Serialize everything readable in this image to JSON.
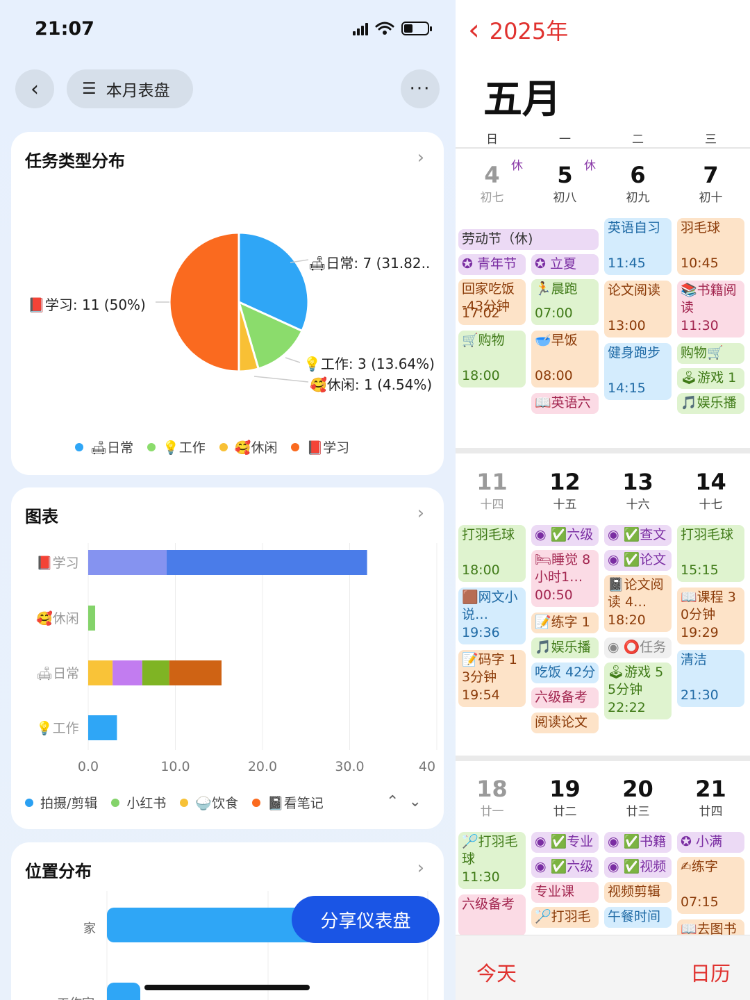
{
  "status_bar": {
    "time": "21:07"
  },
  "dashboard": {
    "title": "本月表盘",
    "more": "···",
    "share_button": "分享仪表盘",
    "pie_card": {
      "title": "任务类型分布",
      "labels": {
        "daily": "🛋日常: 7 (31.82..",
        "work": "💡工作: 3 (13.64%)",
        "leisure": "🥰休闲: 1 (4.54%)",
        "study": "📕学习: 11 (50%)"
      },
      "legend": [
        "🛋日常",
        "💡工作",
        "🥰休闲",
        "📕学习"
      ],
      "colors": [
        "#2fa6f6",
        "#8bdc6c",
        "#f8c035",
        "#fa6a1f"
      ]
    },
    "bar_card": {
      "title": "图表",
      "legend": [
        "拍摄/剪辑",
        "小红书",
        "🍚饮食",
        "📓看笔记"
      ],
      "legend_colors": [
        "#2aa0f2",
        "#84d36a",
        "#f7c136",
        "#fb6a1e"
      ]
    },
    "location_card": {
      "title": "位置分布",
      "rows": [
        "家",
        "工作室"
      ]
    }
  },
  "chart_data": [
    {
      "type": "pie",
      "title": "任务类型分布",
      "categories": [
        "日常",
        "工作",
        "休闲",
        "学习"
      ],
      "values": [
        7,
        3,
        1,
        11
      ],
      "percent": [
        31.82,
        13.64,
        4.54,
        50
      ]
    },
    {
      "type": "bar",
      "orientation": "horizontal",
      "title": "图表",
      "categories": [
        "学习",
        "休闲",
        "日常",
        "工作"
      ],
      "category_labels": [
        "📕学习",
        "🥰休闲",
        "🛋日常",
        "💡工作"
      ],
      "stacks": [
        [
          {
            "value": 9,
            "color": "#8593f0"
          },
          {
            "value": 23,
            "color": "#4a7ce9"
          }
        ],
        [
          {
            "value": 0.8,
            "color": "#84d36a"
          }
        ],
        [
          {
            "value": 2.8,
            "color": "#f9c338"
          },
          {
            "value": 3.4,
            "color": "#c27cf0"
          },
          {
            "value": 3.1,
            "color": "#7fb424"
          },
          {
            "value": 6,
            "color": "#cf6314"
          }
        ],
        [
          {
            "value": 3.3,
            "color": "#2fa6f6"
          }
        ]
      ],
      "x_ticks": [
        "0.0",
        "10.0",
        "20.0",
        "30.0",
        "40"
      ],
      "xlim": [
        0,
        40
      ],
      "grid": true
    },
    {
      "type": "bar",
      "orientation": "horizontal",
      "title": "位置分布",
      "categories": [
        "家",
        "工作室"
      ],
      "values": [
        null,
        null
      ]
    }
  ],
  "calendar": {
    "back_label": "2025年",
    "month": "五月",
    "weekdays": [
      "日",
      "一",
      "二",
      "三"
    ],
    "weeks": [
      {
        "days": [
          {
            "num": "4",
            "lunar": "初七",
            "xiu": "休",
            "past": true
          },
          {
            "num": "5",
            "lunar": "初八",
            "xiu": "休",
            "past": false
          },
          {
            "num": "6",
            "lunar": "初九",
            "past": false
          },
          {
            "num": "7",
            "lunar": "初十",
            "past": false
          }
        ],
        "events": [
          {
            "col": 0,
            "span": 2,
            "row": 330,
            "h": 30,
            "text": "劳动节（休)",
            "bg": "#ecdaf5"
          },
          {
            "col": 0,
            "row": 366,
            "h": 30,
            "text": "✪ 青年节",
            "bg": "#ecdaf5",
            "color": "#7a2da2"
          },
          {
            "col": 1,
            "row": 366,
            "h": 30,
            "text": "✪ 立夏",
            "bg": "#ecdaf5",
            "color": "#7a2da2"
          },
          {
            "col": 0,
            "row": 402,
            "h": 66,
            "text": "回家吃饭 -43分钟",
            "time": "17:02",
            "bg": "#fde3c8",
            "color": "#8b3b09"
          },
          {
            "col": 1,
            "row": 402,
            "h": 66,
            "text": "🏃晨跑",
            "time": "07:00",
            "bg": "#dff3cf",
            "color": "#3f7a17"
          },
          {
            "col": 0,
            "row": 476,
            "h": 82,
            "text": "🛒购物",
            "time": "18:00",
            "bg": "#dff3cf",
            "color": "#3f7a17"
          },
          {
            "col": 1,
            "row": 476,
            "h": 82,
            "text": "🥣早饭",
            "time": "08:00",
            "bg": "#fde3c8",
            "color": "#8b3b09"
          },
          {
            "col": 1,
            "row": 566,
            "h": 30,
            "text": "📖英语六",
            "bg": "#fbdbe5",
            "color": "#a2254f"
          },
          {
            "col": 2,
            "row": 314,
            "h": 82,
            "text": "英语自习",
            "time": "11:45",
            "bg": "#d4ecfd",
            "color": "#1f6aa5"
          },
          {
            "col": 2,
            "row": 404,
            "h": 82,
            "text": "论文阅读",
            "time": "13:00",
            "bg": "#fde3c8",
            "color": "#8b3b09"
          },
          {
            "col": 2,
            "row": 494,
            "h": 82,
            "text": "健身跑步",
            "time": "14:15",
            "bg": "#d4ecfd",
            "color": "#1f6aa5"
          },
          {
            "col": 3,
            "row": 314,
            "h": 82,
            "text": "羽毛球",
            "time": "10:45",
            "bg": "#fde3c8",
            "color": "#8b3b09"
          },
          {
            "col": 3,
            "row": 404,
            "h": 82,
            "text": "📚书籍阅读",
            "time": "11:30",
            "bg": "#fbdbe5",
            "color": "#a2254f"
          },
          {
            "col": 3,
            "row": 494,
            "h": 30,
            "text": "购物🛒",
            "bg": "#dff3cf",
            "color": "#3f7a17"
          },
          {
            "col": 3,
            "row": 530,
            "h": 30,
            "text": "🕹游戏 1",
            "bg": "#dff3cf",
            "color": "#3f7a17"
          },
          {
            "col": 3,
            "row": 566,
            "h": 30,
            "text": "🎵娱乐播",
            "bg": "#dff3cf",
            "color": "#3f7a17"
          }
        ]
      },
      {
        "days": [
          {
            "num": "11",
            "lunar": "十四",
            "past": true
          },
          {
            "num": "12",
            "lunar": "十五",
            "past": false
          },
          {
            "num": "13",
            "lunar": "十六",
            "past": false
          },
          {
            "num": "14",
            "lunar": "十七",
            "past": false
          }
        ],
        "events": [
          {
            "col": 0,
            "row": 756,
            "h": 82,
            "text": "打羽毛球",
            "time": "18:00",
            "bg": "#dff3cf",
            "color": "#3f7a17"
          },
          {
            "col": 0,
            "row": 846,
            "h": 82,
            "text": "🟫网文小说…",
            "time": "19:36",
            "bg": "#d4ecfd",
            "color": "#1f6aa5"
          },
          {
            "col": 0,
            "row": 936,
            "h": 82,
            "text": "📝码字 13分钟",
            "time": "19:54",
            "bg": "#fde3c8",
            "color": "#8b3b09"
          },
          {
            "col": 1,
            "row": 756,
            "h": 30,
            "text": "◉ ✅六级",
            "bg": "#ecdaf5",
            "color": "#7a2da2"
          },
          {
            "col": 1,
            "row": 792,
            "h": 82,
            "text": "🛏睡觉 8小时1…",
            "time": "00:50",
            "bg": "#fbdbe5",
            "color": "#a2254f"
          },
          {
            "col": 1,
            "row": 882,
            "h": 30,
            "text": "📝练字 1",
            "bg": "#fde3c8",
            "color": "#8b3b09"
          },
          {
            "col": 1,
            "row": 918,
            "h": 30,
            "text": "🎵娱乐播",
            "bg": "#dff3cf",
            "color": "#3f7a17"
          },
          {
            "col": 1,
            "row": 954,
            "h": 30,
            "text": "吃饭 42分",
            "bg": "#d4ecfd",
            "color": "#1f6aa5"
          },
          {
            "col": 1,
            "row": 990,
            "h": 30,
            "text": "六级备考",
            "bg": "#fbdbe5",
            "color": "#a2254f"
          },
          {
            "col": 1,
            "row": 1026,
            "h": 30,
            "text": "阅读论文",
            "bg": "#fde3c8",
            "color": "#8b3b09"
          },
          {
            "col": 2,
            "row": 756,
            "h": 30,
            "text": "◉ ✅查文",
            "bg": "#ecdaf5",
            "color": "#7a2da2"
          },
          {
            "col": 2,
            "row": 792,
            "h": 30,
            "text": "◉ ✅论文",
            "bg": "#ecdaf5",
            "color": "#7a2da2"
          },
          {
            "col": 2,
            "row": 828,
            "h": 82,
            "text": "📓论文阅读 4…",
            "time": "18:20",
            "bg": "#fde3c8",
            "color": "#8b3b09"
          },
          {
            "col": 2,
            "row": 918,
            "h": 30,
            "text": "◉ ⭕任务",
            "bg": "#f0f0f0",
            "color": "#888"
          },
          {
            "col": 2,
            "row": 954,
            "h": 82,
            "text": "🕹游戏 55分钟",
            "time": "22:22",
            "bg": "#dff3cf",
            "color": "#3f7a17"
          },
          {
            "col": 3,
            "row": 756,
            "h": 82,
            "text": "打羽毛球",
            "time": "15:15",
            "bg": "#dff3cf",
            "color": "#3f7a17"
          },
          {
            "col": 3,
            "row": 846,
            "h": 82,
            "text": "📖课程 30分钟",
            "time": "19:29",
            "bg": "#fde3c8",
            "color": "#8b3b09"
          },
          {
            "col": 3,
            "row": 936,
            "h": 82,
            "text": "清洁",
            "time": "21:30",
            "bg": "#d4ecfd",
            "color": "#1f6aa5"
          }
        ]
      },
      {
        "days": [
          {
            "num": "18",
            "lunar": "廿一",
            "past": true
          },
          {
            "num": "19",
            "lunar": "廿二",
            "past": false
          },
          {
            "num": "20",
            "lunar": "廿三",
            "past": false
          },
          {
            "num": "21",
            "lunar": "廿四",
            "past": false
          }
        ],
        "events": [
          {
            "col": 0,
            "row": 1198,
            "h": 82,
            "text": "🏸打羽毛球",
            "time": "11:30",
            "bg": "#dff3cf",
            "color": "#3f7a17"
          },
          {
            "col": 0,
            "row": 1288,
            "h": 60,
            "text": "六级备考",
            "bg": "#fbdbe5",
            "color": "#a2254f"
          },
          {
            "col": 1,
            "row": 1198,
            "h": 30,
            "text": "◉ ✅专业",
            "bg": "#ecdaf5",
            "color": "#7a2da2"
          },
          {
            "col": 1,
            "row": 1234,
            "h": 30,
            "text": "◉ ✅六级",
            "bg": "#ecdaf5",
            "color": "#7a2da2"
          },
          {
            "col": 1,
            "row": 1270,
            "h": 30,
            "text": "专业课",
            "bg": "#fbdbe5",
            "color": "#a2254f"
          },
          {
            "col": 1,
            "row": 1306,
            "h": 30,
            "text": "🏸打羽毛",
            "bg": "#fde3c8",
            "color": "#8b3b09"
          },
          {
            "col": 2,
            "row": 1198,
            "h": 30,
            "text": "◉ ✅书籍",
            "bg": "#ecdaf5",
            "color": "#7a2da2"
          },
          {
            "col": 2,
            "row": 1234,
            "h": 30,
            "text": "◉ ✅视频",
            "bg": "#ecdaf5",
            "color": "#7a2da2"
          },
          {
            "col": 2,
            "row": 1270,
            "h": 30,
            "text": "视频剪辑",
            "bg": "#fde3c8",
            "color": "#8b3b09"
          },
          {
            "col": 2,
            "row": 1306,
            "h": 30,
            "text": "午餐时间",
            "bg": "#d4ecfd",
            "color": "#1f6aa5"
          },
          {
            "col": 3,
            "row": 1198,
            "h": 30,
            "text": "✪ 小满",
            "bg": "#ecdaf5",
            "color": "#7a2da2"
          },
          {
            "col": 3,
            "row": 1234,
            "h": 82,
            "text": "✍练字",
            "time": "07:15",
            "bg": "#fde3c8",
            "color": "#8b3b09"
          },
          {
            "col": 3,
            "row": 1324,
            "h": 30,
            "text": "📖去图书",
            "bg": "#fde3c8",
            "color": "#8b3b09"
          }
        ]
      }
    ],
    "today_label": "今天",
    "calendar_label": "日历"
  }
}
